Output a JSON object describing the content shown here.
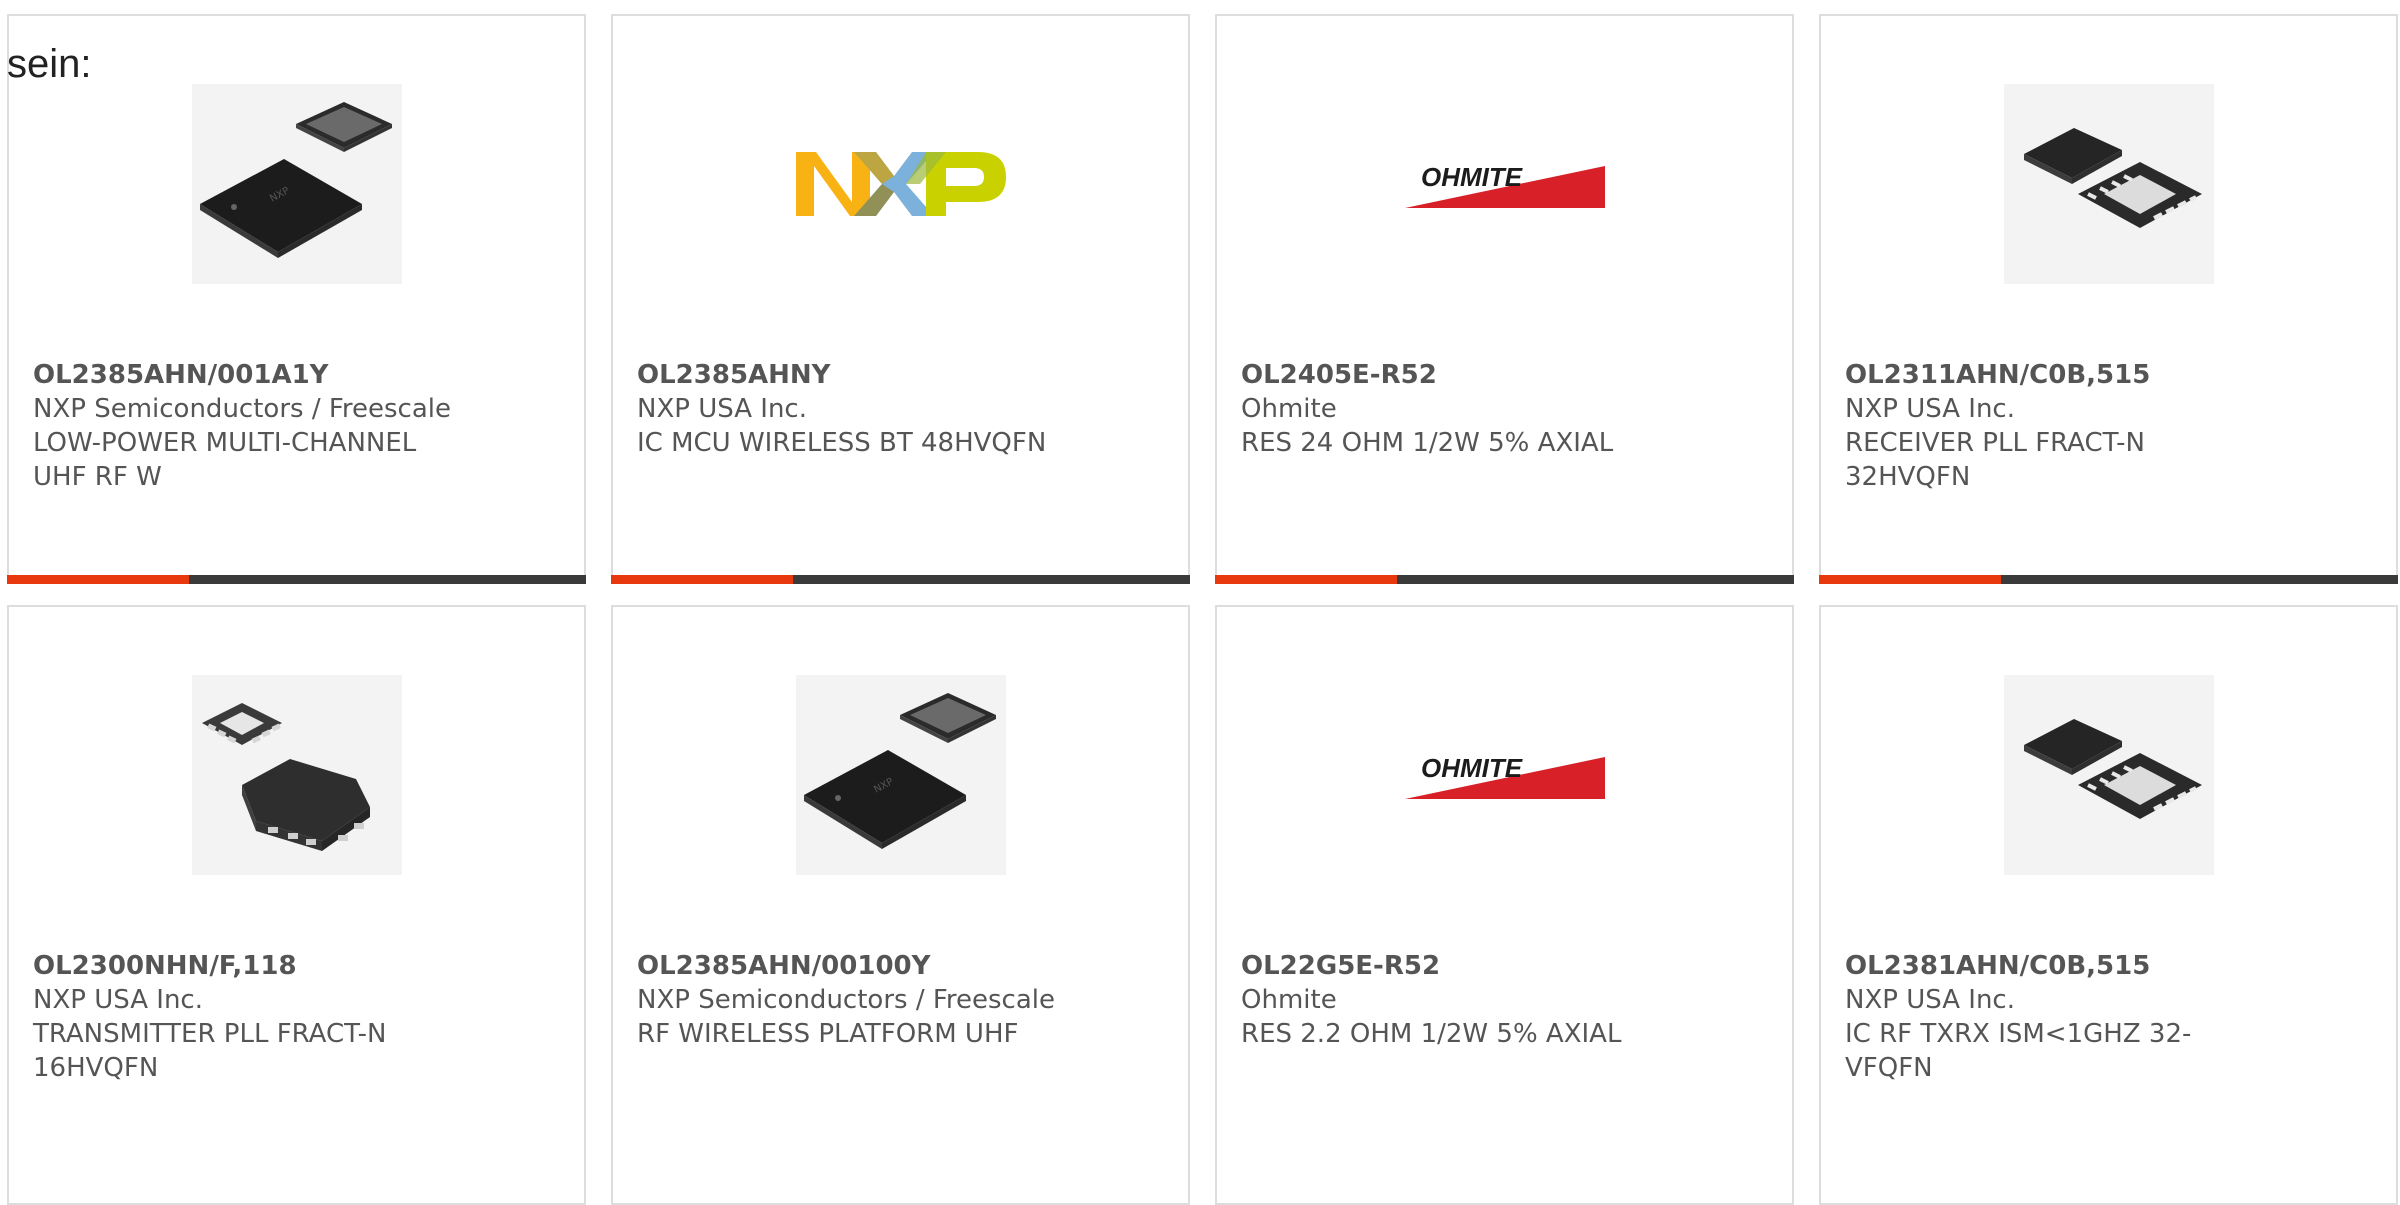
{
  "intro_text": "sein:",
  "accent_color": "#e8380d",
  "bar_color": "#3a3a3a",
  "products": [
    {
      "part_number": "OL2385AHN/001A1Y",
      "manufacturer": "NXP Semiconductors / Freescale",
      "description": "LOW-POWER MULTI-CHANNEL UHF RF W",
      "image": "qfn-chip-pair-black"
    },
    {
      "part_number": "OL2385AHNY",
      "manufacturer": "NXP USA Inc.",
      "description": "IC MCU WIRELESS BT 48HVQFN",
      "image": "nxp-logo"
    },
    {
      "part_number": "OL2405E-R52",
      "manufacturer": "Ohmite",
      "description": "RES 24 OHM 1/2W 5% AXIAL",
      "image": "ohmite-logo"
    },
    {
      "part_number": "OL2311AHN/C0B,515",
      "manufacturer": "NXP USA Inc.",
      "description": "RECEIVER PLL FRACT-N 32HVQFN",
      "image": "qfn-chip-pair-gray"
    },
    {
      "part_number": "OL2300NHN/F,118",
      "manufacturer": "NXP USA Inc.",
      "description": "TRANSMITTER PLL FRACT-N 16HVQFN",
      "image": "hvqfn16-chip-pair"
    },
    {
      "part_number": "OL2385AHN/00100Y",
      "manufacturer": "NXP Semiconductors / Freescale",
      "description": "RF WIRELESS PLATFORM UHF",
      "image": "qfn-chip-pair-black"
    },
    {
      "part_number": "OL22G5E-R52",
      "manufacturer": "Ohmite",
      "description": "RES 2.2 OHM 1/2W 5% AXIAL",
      "image": "ohmite-logo"
    },
    {
      "part_number": "OL2381AHN/C0B,515",
      "manufacturer": "NXP USA Inc.",
      "description": "IC RF TXRX ISM<1GHZ 32-VFQFN",
      "image": "qfn-chip-pair-gray"
    }
  ]
}
